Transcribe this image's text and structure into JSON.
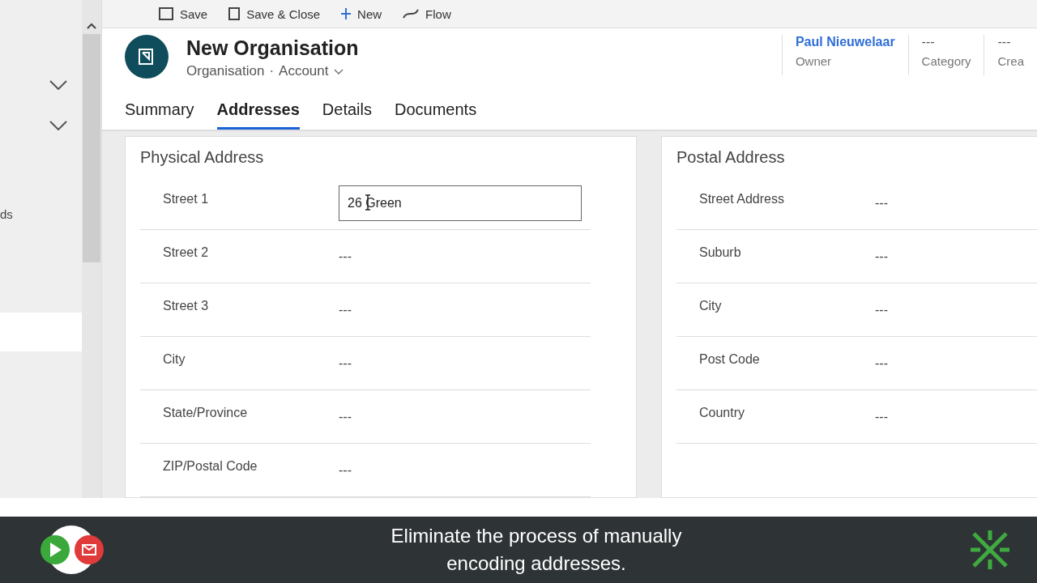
{
  "toolbar": {
    "items": [
      {
        "label": "Save",
        "kind": "save"
      },
      {
        "label": "Save & Close",
        "kind": "saveclose"
      },
      {
        "label": "New",
        "kind": "new"
      },
      {
        "label": "Flow",
        "kind": "flow"
      }
    ]
  },
  "sidebar": {
    "items": [
      {
        "kind": "chevron"
      },
      {
        "kind": "chevron"
      },
      {
        "kind": "text",
        "label": "ds"
      },
      {
        "kind": "selected"
      }
    ]
  },
  "record": {
    "title": "New Organisation",
    "entity": "Organisation",
    "separator": "·",
    "form": "Account"
  },
  "header_fields": [
    {
      "value": "Paul Nieuwelaar",
      "label": "Owner",
      "kind": "link"
    },
    {
      "value": "---",
      "label": "Category",
      "kind": "text"
    },
    {
      "value": "---",
      "label": "Crea",
      "kind": "text"
    }
  ],
  "tabs": [
    {
      "label": "Summary",
      "selected": false
    },
    {
      "label": "Addresses",
      "selected": true
    },
    {
      "label": "Details",
      "selected": false
    },
    {
      "label": "Documents",
      "selected": false
    }
  ],
  "sections": [
    {
      "title": "Physical Address",
      "fields": [
        {
          "label": "Street 1",
          "value": "26 Green",
          "kind": "input"
        },
        {
          "label": "Street 2",
          "value": "---",
          "kind": "text"
        },
        {
          "label": "Street 3",
          "value": "---",
          "kind": "text"
        },
        {
          "label": "City",
          "value": "---",
          "kind": "text"
        },
        {
          "label": "State/Province",
          "value": "---",
          "kind": "text"
        },
        {
          "label": "ZIP/Postal Code",
          "value": "---",
          "kind": "text"
        }
      ]
    },
    {
      "title": "Postal Address",
      "fields": [
        {
          "label": "Street Address",
          "value": "---",
          "kind": "text"
        },
        {
          "label": "Suburb",
          "value": "---",
          "kind": "text"
        },
        {
          "label": "City",
          "value": "---",
          "kind": "text"
        },
        {
          "label": "Post Code",
          "value": "---",
          "kind": "text"
        },
        {
          "label": "Country",
          "value": "---",
          "kind": "text"
        }
      ]
    }
  ],
  "caption": {
    "text": "Eliminate the process of manually encoding addresses."
  }
}
